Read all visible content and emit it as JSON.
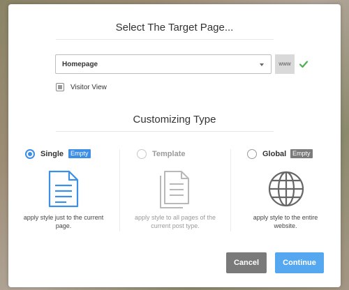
{
  "dialog": {
    "title": "Select The Target Page...",
    "target_select": {
      "value": "Homepage"
    },
    "www_button": "www",
    "visitor_view_label": "Visitor View",
    "customizing_title": "Customizing Type",
    "options": [
      {
        "label": "Single",
        "badge": "Empty",
        "description": "apply style just to the current page.",
        "selected": true,
        "disabled": false,
        "icon": "document-icon"
      },
      {
        "label": "Template",
        "badge": "",
        "description": "apply style to all pages of the current post type.",
        "selected": false,
        "disabled": true,
        "icon": "multi-document-icon"
      },
      {
        "label": "Global",
        "badge": "Empty",
        "description": "apply style to the entire website.",
        "selected": false,
        "disabled": false,
        "icon": "globe-icon"
      }
    ],
    "cancel_label": "Cancel",
    "continue_label": "Continue"
  },
  "colors": {
    "accent": "#3d8ee6",
    "continue_button": "#55a8ef",
    "cancel_button": "#7a7a7a",
    "check": "#4caf50"
  }
}
